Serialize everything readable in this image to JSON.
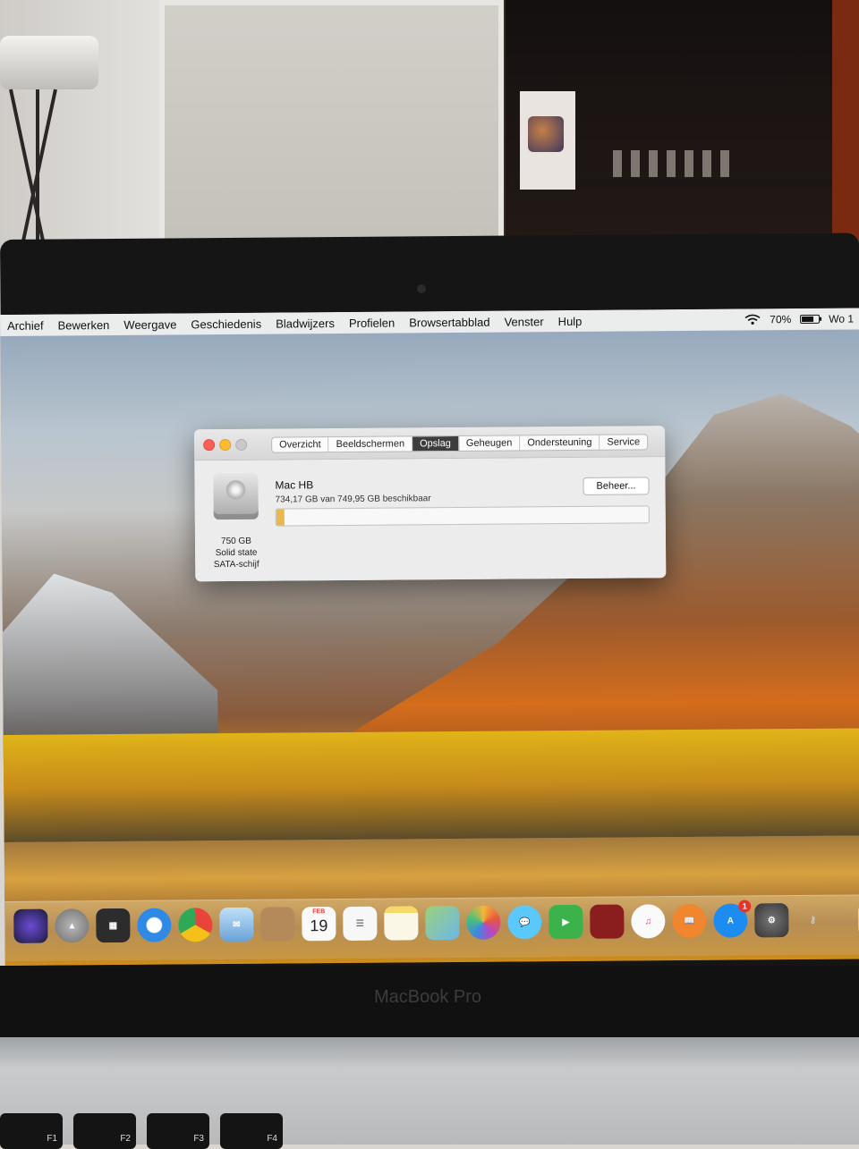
{
  "menubar": {
    "items": [
      "Archief",
      "Bewerken",
      "Weergave",
      "Geschiedenis",
      "Bladwijzers",
      "Profielen",
      "Browsertabblad",
      "Venster",
      "Hulp"
    ],
    "battery_percent": "70%",
    "battery_level": 0.7,
    "clock": "Wo 1"
  },
  "window": {
    "tabs": [
      "Overzicht",
      "Beeldschermen",
      "Opslag",
      "Geheugen",
      "Ondersteuning",
      "Service"
    ],
    "active_tab": "Opslag",
    "disk": {
      "capacity": "750 GB",
      "type": "Solid state",
      "interface": "SATA-schijf"
    },
    "volume_name": "Mac HB",
    "available_text": "734,17 GB van 749,95 GB beschikbaar",
    "used_fraction": 0.021,
    "manage_button": "Beheer..."
  },
  "dock": {
    "icons": [
      "siri-icon",
      "launchpad-icon",
      "mission-control-icon",
      "safari-icon",
      "chrome-icon",
      "mail-icon",
      "contacts-icon",
      "calendar-icon",
      "reminders-icon",
      "notes-icon",
      "maps-icon",
      "photos-icon",
      "messages-icon",
      "facetime-icon",
      "photo-booth-icon",
      "itunes-icon",
      "ibooks-icon",
      "app-store-icon",
      "system-preferences-icon",
      "keychain-icon",
      "finder-icon"
    ],
    "calendar_month": "FEB",
    "calendar_day": "19",
    "app_store_badge": "1"
  },
  "laptop": {
    "brand": "MacBook Pro",
    "keys": [
      "F1",
      "F2",
      "F3",
      "F4"
    ]
  },
  "colors": {
    "accent_dark_tab": "#3d3d3d",
    "storage_fill": "#e9b84a",
    "close": "#fc5f57",
    "minimize": "#fdbc2e"
  }
}
